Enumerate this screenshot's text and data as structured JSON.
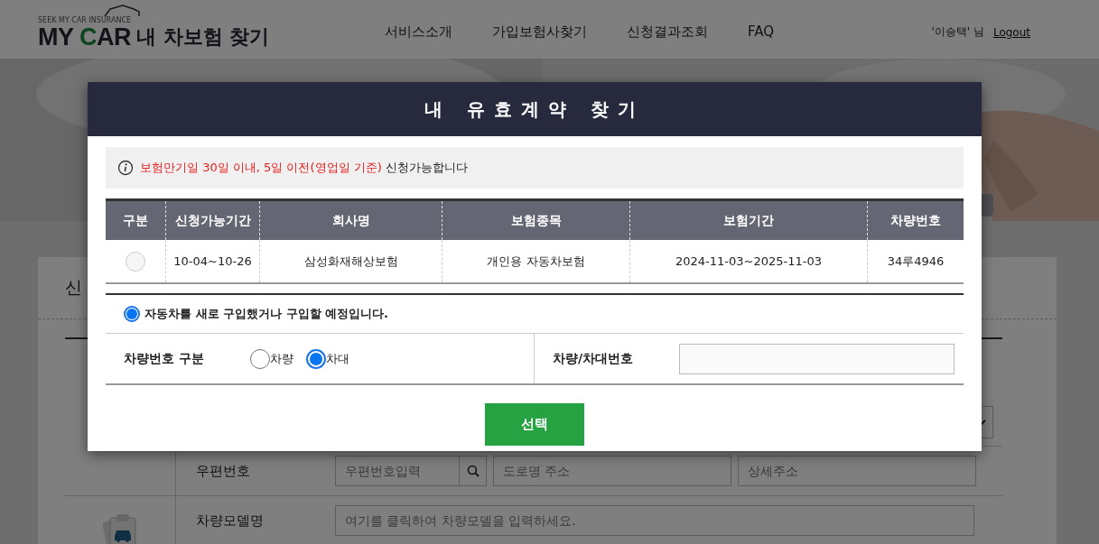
{
  "header": {
    "logo": {
      "tagline": "SEEK MY CAR INSURANCE",
      "parts": [
        {
          "text": "MY ",
          "accent": false
        },
        {
          "text": "C",
          "accent": true
        },
        {
          "text": "AR",
          "accent": false
        }
      ],
      "title": "내 차보험 찾기"
    },
    "nav": [
      "서비스소개",
      "가입보험사찾기",
      "신청결과조회",
      "FAQ"
    ],
    "user": "'이승택' 님",
    "logout": "Logout"
  },
  "form": {
    "title": "신",
    "rows": [
      {
        "kind": "address",
        "label": "우편번호",
        "fields": [
          {
            "placeholder": "우편번호입력",
            "search": true
          },
          {
            "placeholder": "도로명 주소",
            "search": false
          },
          {
            "placeholder": "상세주소",
            "search": false
          }
        ]
      },
      {
        "kind": "text",
        "label": "차량모델명",
        "fields": [
          {
            "placeholder": "여기를 클릭하여 차량모델을 입력하세요.",
            "search": false
          }
        ]
      }
    ]
  },
  "modal": {
    "title": "내 유효계약 찾기",
    "notice": {
      "highlight": "보험만기일 30일 이내, 5일 이전(영업일 기준)",
      "rest": " 신청가능합니다"
    },
    "table": {
      "columns": [
        "구분",
        "신청가능기간",
        "회사명",
        "보험종목",
        "보험기간",
        "차량번호"
      ],
      "rows": [
        {
          "selected": false,
          "cells": [
            "",
            "10-04~10-26",
            "삼성화재해상보험",
            "개인용 자동차보험",
            "2024-11-03~2025-11-03",
            "34루4946"
          ]
        }
      ]
    },
    "new_car": {
      "label": "자동차를 새로 구입했거나 구입할 예정입니다.",
      "checked": true
    },
    "plate_type": {
      "label": "차량번호 구분",
      "options": [
        {
          "label": "차량",
          "selected": false
        },
        {
          "label": "차대",
          "selected": true
        }
      ]
    },
    "plate_number": {
      "label": "차량/차대번호"
    },
    "button": "선택"
  }
}
